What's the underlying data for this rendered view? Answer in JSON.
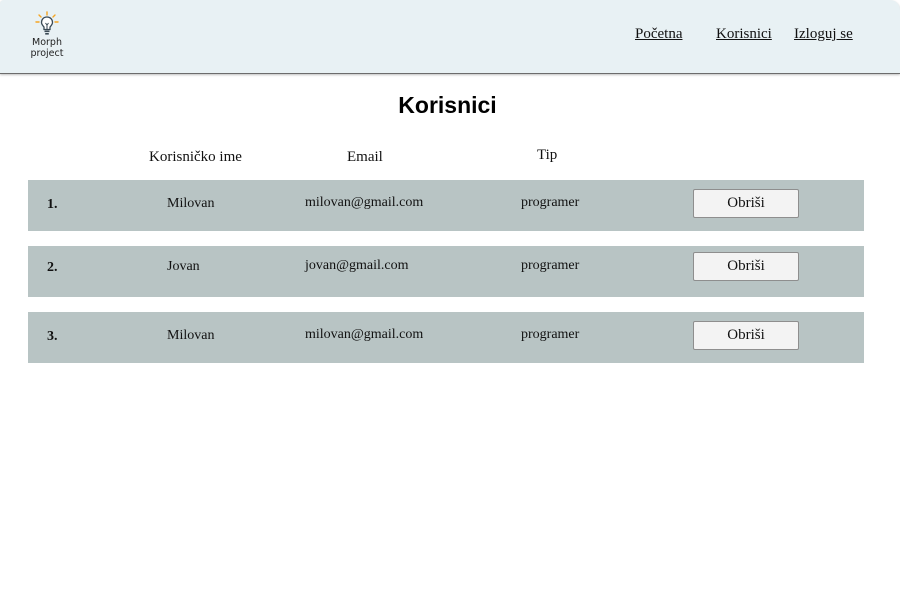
{
  "logo": {
    "line1": "Morph",
    "line2": "project",
    "icon": "lightbulb-icon"
  },
  "nav": {
    "home": "Početna",
    "users": "Korisnici",
    "logout": "Izloguj se"
  },
  "page": {
    "title": "Korisnici"
  },
  "table": {
    "headers": {
      "username": "Korisničko ime",
      "email": "Email",
      "type": "Tip"
    },
    "rows": [
      {
        "num": "1.",
        "username": "Milovan",
        "email": "milovan@gmail.com",
        "type": "programer",
        "action": "Obriši"
      },
      {
        "num": "2.",
        "username": "Jovan",
        "email": "jovan@gmail.com",
        "type": "programer",
        "action": "Obriši"
      },
      {
        "num": "3.",
        "username": "Milovan",
        "email": "milovan@gmail.com",
        "type": "programer",
        "action": "Obriši"
      }
    ]
  },
  "colors": {
    "navbar_bg": "#e8f1f4",
    "row_bg": "#b8c4c4",
    "bulb_accent": "#f5a623"
  }
}
